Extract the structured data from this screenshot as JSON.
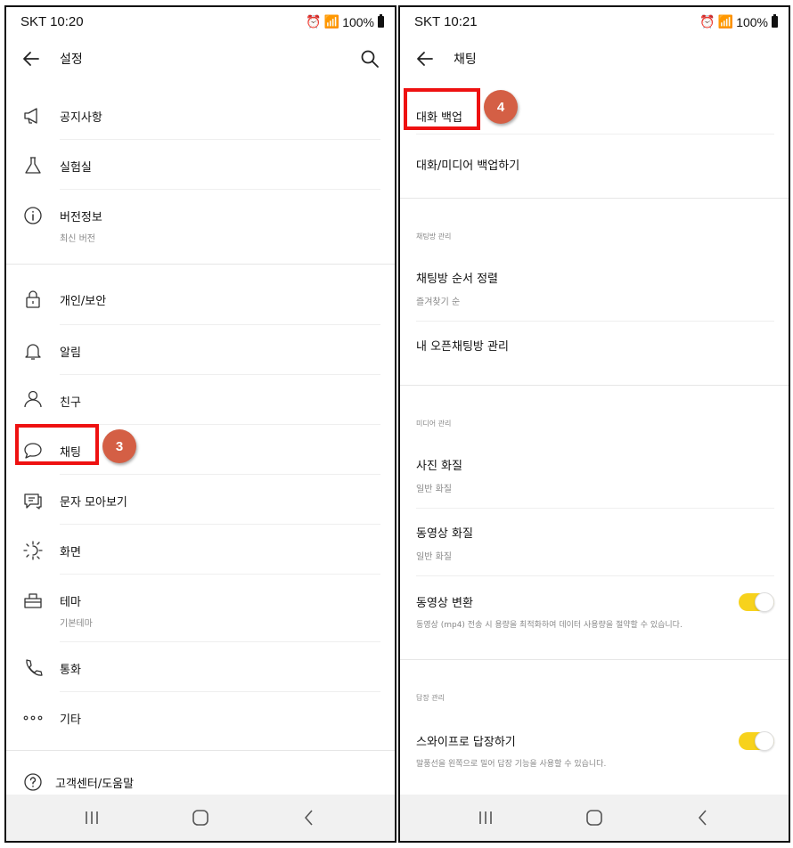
{
  "left_screen": {
    "status": {
      "time": "SKT 10:20",
      "battery": "100%"
    },
    "title": "설정",
    "items": [
      {
        "label": "공지사항",
        "sub": ""
      },
      {
        "label": "실험실",
        "sub": ""
      },
      {
        "label": "버전정보",
        "sub": "최신 버전"
      },
      {
        "label": "개인/보안",
        "sub": ""
      },
      {
        "label": "알림",
        "sub": ""
      },
      {
        "label": "친구",
        "sub": ""
      },
      {
        "label": "채팅",
        "sub": ""
      },
      {
        "label": "문자 모아보기",
        "sub": ""
      },
      {
        "label": "화면",
        "sub": ""
      },
      {
        "label": "테마",
        "sub": "기본테마"
      },
      {
        "label": "통화",
        "sub": ""
      },
      {
        "label": "기타",
        "sub": ""
      },
      {
        "label": "고객센터/도움말",
        "sub": ""
      }
    ],
    "badge": "3"
  },
  "right_screen": {
    "status": {
      "time": "SKT 10:21",
      "battery": "100%"
    },
    "title": "채팅",
    "backup_title": "대화 백업",
    "backup_item": "대화/미디어 백업하기",
    "room_header": "채팅방 관리",
    "room_sort": {
      "label": "채팅방 순서 정렬",
      "sub": "즐겨찾기 순"
    },
    "open_chat": "내 오픈채팅방 관리",
    "media_header": "미디어 관리",
    "photo_quality": {
      "label": "사진 화질",
      "sub": "일반 화질"
    },
    "video_quality": {
      "label": "동영상 화질",
      "sub": "일반 화질"
    },
    "video_convert": {
      "label": "동영상 변환",
      "sub": "동영상 (mp4) 전송 시 용량을 최적화하여 데이터 사용량을 절약할 수 있습니다.",
      "on": true
    },
    "reply_header": "답장 관리",
    "swipe_reply": {
      "label": "스와이프로 답장하기",
      "sub": "말풍선을 왼쪽으로 밀어 답장 기능을 사용할 수 있습니다.",
      "on": true
    },
    "badge": "4"
  },
  "colors": {
    "highlight": "#ee1111",
    "badge": "#d45f45",
    "toggle_on": "#f7d21c"
  }
}
